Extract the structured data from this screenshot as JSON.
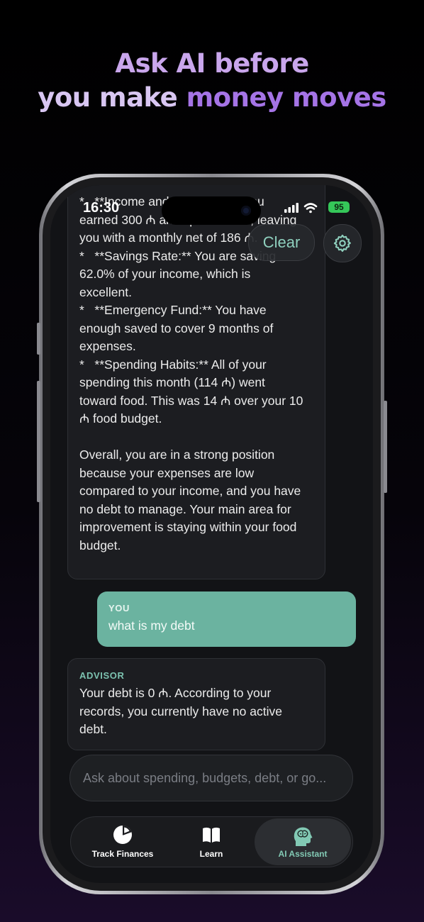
{
  "headline": {
    "line1": "Ask AI before",
    "line2_part1": "you make ",
    "line2_part2": "money moves"
  },
  "status_bar": {
    "time": "16:30",
    "battery": "95"
  },
  "toolbar": {
    "clear_label": "Clear",
    "settings_icon": "gear-icon"
  },
  "chat": {
    "messages": [
      {
        "role": "advisor",
        "text": "*   **Income and Expenses:** You\nearned 300 ₼ and spent 114 ₼, leaving\nyou with a monthly net of 186 ₼.\n*   **Savings Rate:** You are saving\n62.0% of your income, which is\nexcellent.\n*   **Emergency Fund:** You have\nenough saved to cover 9 months of\nexpenses.\n*   **Spending Habits:** All of your\nspending this month (114 ₼) went\ntoward food. This was 14 ₼ over your 10\n₼ food budget.\n\nOverall, you are in a strong position\nbecause your expenses are low\ncompared to your income, and you have\nno debt to manage. Your main area for\nimprovement is staying within your food\nbudget."
      },
      {
        "role_label": "YOU",
        "text": "what is my debt"
      },
      {
        "role_label": "ADVISOR",
        "text": "Your debt is 0 ₼. According to your\nrecords, you currently have no active\ndebt."
      }
    ]
  },
  "input": {
    "placeholder": "Ask about spending, budgets, debt, or go..."
  },
  "tabbar": {
    "tabs": [
      {
        "label": "Track Finances",
        "icon": "pie-chart-icon"
      },
      {
        "label": "Learn",
        "icon": "book-icon"
      },
      {
        "label": "AI Assistant",
        "icon": "brain-head-icon",
        "active": true
      }
    ]
  },
  "colors": {
    "accent": "#6bb3a0",
    "accent_text": "#82c9b4",
    "headline_purple": "#a574e6"
  }
}
